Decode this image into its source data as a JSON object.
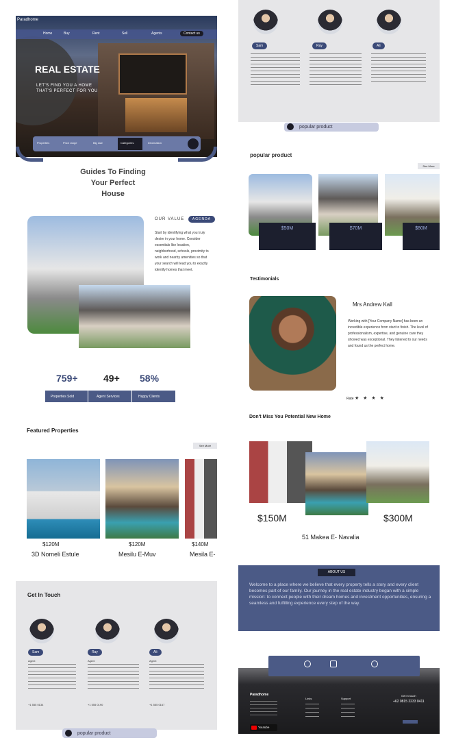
{
  "hero": {
    "brand": "Paradhome",
    "nav": [
      "Home",
      "Buy",
      "Rent",
      "Sell",
      "Agents",
      "Contact"
    ],
    "contact_button": "Contact us",
    "title": "REAL ESTATE",
    "subtitle_line1": "LET'S FIND YOU A HOME",
    "subtitle_line2": "THAT'S PERFECT FOR YOU",
    "search_tabs": [
      "Properties",
      "Price range",
      "Big size",
      "Categories",
      "Information"
    ]
  },
  "guides": {
    "title_line1": "Guides To Finding",
    "title_line2": "Your Perfect",
    "title_line3": "House"
  },
  "values": {
    "label": "OUR VALUE",
    "badge": "AGENDA",
    "text": "Start by identifying what you truly desire in your home. Consider essentials like location, neighborhood, schools, proximity to work and nearby amenities so that your search will lead you to exactly identify homes that meet."
  },
  "stats": {
    "items": [
      {
        "value": "759+",
        "label": "Properties Sold"
      },
      {
        "value": "49+",
        "label": "Agent Services"
      },
      {
        "value": "58%",
        "label": "Happy Clients"
      }
    ]
  },
  "featured": {
    "title": "Featured Properties",
    "see_more": "See More",
    "items": [
      {
        "price": "$120M",
        "name": "3D Nomeli Estule"
      },
      {
        "price": "$120M",
        "name": "Mesilu E-Muv"
      },
      {
        "price": "$140M",
        "name": "Mesila E-"
      }
    ]
  },
  "get_in_touch": {
    "title": "Get In Touch",
    "agents": [
      {
        "role": "Agent",
        "name": "Sam",
        "phone": "+1 555 0134"
      },
      {
        "role": "Agent",
        "name": "Ray",
        "phone": "+1 555 0190"
      },
      {
        "role": "Agent",
        "name": "Ali",
        "phone": "+1 555 0167"
      }
    ],
    "search_placeholder": "popular product"
  },
  "top_agents": {
    "agents": [
      {
        "name": "Sam"
      },
      {
        "name": "Ray"
      },
      {
        "name": "Ali"
      }
    ],
    "search_placeholder": "popular product"
  },
  "popular": {
    "title": "popular product",
    "see_more": "See More",
    "items": [
      {
        "price": "$50M"
      },
      {
        "price": "$70M"
      },
      {
        "price": "$80M"
      }
    ]
  },
  "testimonials": {
    "title": "Testimonials",
    "name": "Mrs Andrew Kall",
    "quote": "Working with [Your Company Name] has been an incredible experience from start to finish. The level of professionalism, expertise, and genuine care they showed was exceptional. They listened to our needs and found us the perfect home.",
    "rating_label": "Rate",
    "stars": "★ ★ ★ ★"
  },
  "potential": {
    "title": "Don't Miss You Potential New Home",
    "price_left": "$150M",
    "price_right": "$300M",
    "name": "51 Makea E- Navalia"
  },
  "about": {
    "badge": "ABOUT US",
    "text": "Welcome to a place where we believe that every property tells a story and every client becomes part of our family. Our journey in the real estate industry began with a simple mission: to connect people with their dream homes and investment opportunities, ensuring a seamless and fulfilling experience every step of the way."
  },
  "footer": {
    "brand": "Paradhome",
    "col2_title": "Links",
    "col3_title": "Support",
    "contact_title": "Get in touch",
    "phone": "+62 0815 2233 0411",
    "youtube": "Youtube"
  },
  "colors": {
    "accent": "#4b5a86",
    "dark": "#1c1f2e",
    "panel": "#e6e6e8"
  }
}
